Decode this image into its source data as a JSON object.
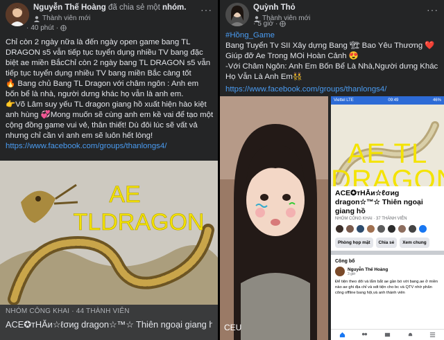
{
  "left_post": {
    "author": "Nguyễn Thế Hoàng",
    "action": "đã chia sẻ một",
    "target": "nhóm.",
    "member_label": "Thành viên mới",
    "time": "40 phút",
    "more": "···",
    "paragraphs": [
      "Chỉ còn 2 ngày nữa là đến ngày open game bang TL DRAGON s5 vẫn tiếp tục tuyển dụng nhiều TV bang đặc biệt ae miền BắcChỉ còn 2 ngày bang TL DRAGON s5 vẫn tiếp tục tuyển dụng nhiều TV bang miền Bắc càng tốt",
      "🔥 Bang chủ Bang TL Dragon  với châm ngôn : Anh em bốn bể là nhà, người dưng khác họ vẫn là anh em.",
      " 👉Võ Lâm suy yếu  TL dragon giang hồ xuất hiện hào kiệt anh hùng 💞Mong muốn sẽ cùng anh em kề vai để tạo một cộng đồng game vui vẻ, thân thiết! Dù đôi lúc sẽ  vất vả nhưng chỉ cần vì anh em sẽ luôn hết lòng!"
    ],
    "link": "https://www.facebook.com/groups/thanlongs4/",
    "image_text_1": "AE",
    "image_text_2": "TLDRAGON",
    "group_meta": "NHÓM CÔNG KHAI · 44 THÀNH VIÊN",
    "group_name": "ACE✪тHĂи☆ℓσиg dragon☆™☆ Thiên ngoại giang hồ"
  },
  "right_post": {
    "author": "Quỳnh Thỏ",
    "member_label": "Thành viên mới",
    "time": "5 giờ",
    "more": "···",
    "hashtag": "#Hồng_Game",
    "line1": "Bang Tuyển Tv SII Xây dựng Bang 🏗 Bao Yêu Thương ❤️ Giúp đỡ Ae Trong MOi Hoàn Cảnh 😍",
    "line2": "-Với Châm Ngôn: Anh Em Bốn Bể Là Nhà,Người dưng Khác Họ Vẫn Là Anh Em👯",
    "link": "https://www.facebook.com/groups/thanlongs4/",
    "photo_caption": "CEU",
    "phone": {
      "carrier": "Viettel  LTE",
      "clock": "09:49",
      "battery": "46%",
      "cover_text_1": "AE TL",
      "cover_text_2": "DRAGON",
      "group_name": "ACE✪тHĂи☆ℓσиg dragon☆™☆ Thiên ngoại giang hồ",
      "group_meta": "NHÓM CÔNG KHAI · 37 THÀNH VIÊN",
      "buttons": [
        "Phòng họp mặt",
        "Chia sẻ",
        "Xem chung"
      ],
      "section": "Công bố",
      "post_author": "Nguyễn Thế Hoàng",
      "post_time": "3 giờ",
      "post_text": "Để tiện theo dõi và lắm bắt ae gần bó với bang.ae ở miền nào ae ghi địa chỉ và sdt tiện cho bc và QTV nhờ phân công offline bang hội,và anh thành viên"
    },
    "colors": {
      "link": "#4a9cf2",
      "dragon_yellow": "#f4e300",
      "panel": "#242526"
    }
  }
}
